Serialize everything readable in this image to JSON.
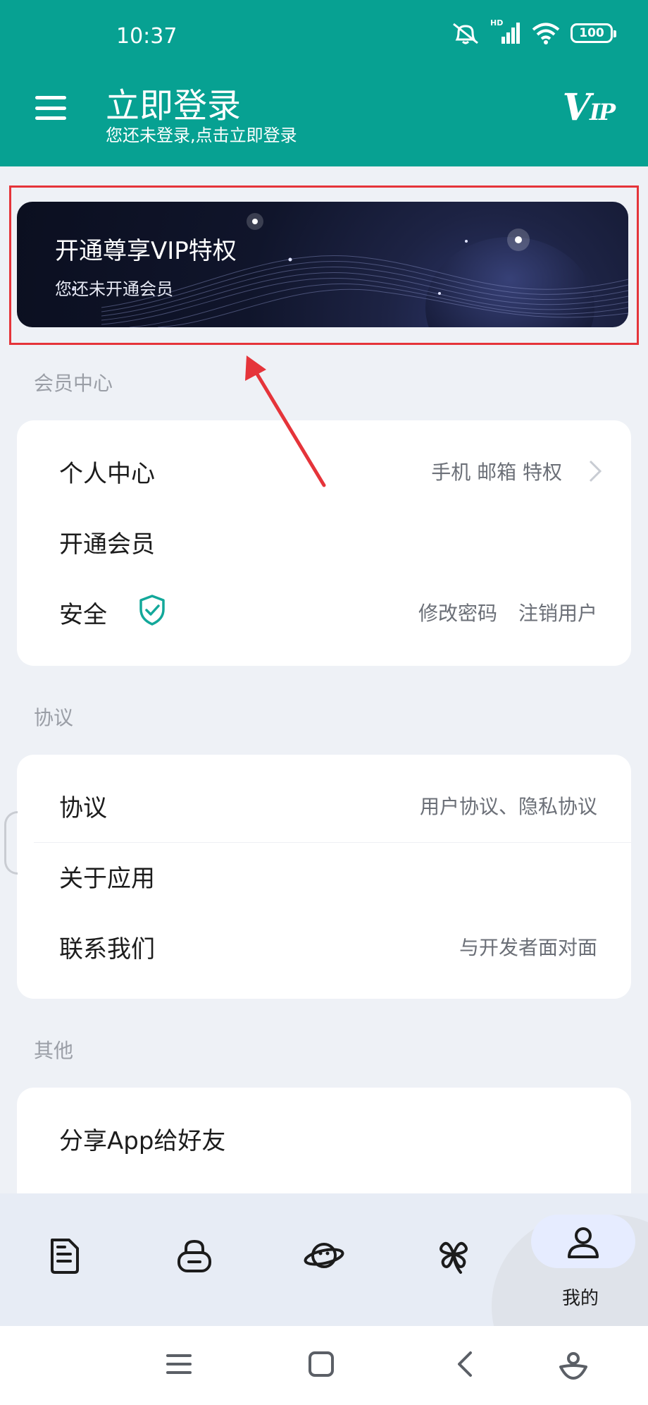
{
  "status_bar": {
    "time": "10:37",
    "hd_label": "HD",
    "battery": "100",
    "icons": [
      "mute-bell-icon",
      "signal-icon",
      "wifi-icon",
      "battery-icon"
    ]
  },
  "header": {
    "title": "立即登录",
    "subtitle": "您还未登录,点击立即登录",
    "vip_logo_main": "V",
    "vip_logo_sub": "IP",
    "bg_color": "#07a192"
  },
  "vip_banner": {
    "title": "开通尊享VIP特权",
    "subtitle": "您还未开通会员"
  },
  "sections": {
    "member": {
      "label": "会员中心",
      "items": [
        {
          "label": "个人中心",
          "right": "手机 邮箱 特权"
        },
        {
          "label": "开通会员",
          "right": ""
        },
        {
          "label": "安全",
          "right_a": "修改密码",
          "right_b": "注销用户"
        }
      ]
    },
    "agreement": {
      "label": "协议",
      "items": [
        {
          "label": "协议",
          "right": "用户协议、隐私协议"
        },
        {
          "label": "关于应用",
          "right": ""
        },
        {
          "label": "联系我们",
          "right": "与开发者面对面"
        }
      ]
    },
    "other": {
      "label": "其他",
      "items": [
        {
          "label": "分享App给好友"
        }
      ]
    }
  },
  "tab_bar": {
    "tabs": [
      {
        "icon": "document-icon"
      },
      {
        "icon": "lock-icon"
      },
      {
        "icon": "planet-icon"
      },
      {
        "icon": "clover-icon"
      },
      {
        "icon": "user-icon",
        "label": "我的",
        "active": true
      }
    ]
  },
  "nav_bar": {
    "buttons": [
      "menu-icon",
      "home-square-icon",
      "back-chevron-icon",
      "assistant-icon"
    ]
  },
  "colors": {
    "accent": "#07a192",
    "highlight_box": "#e5343a",
    "annotation_arrow": "#e5343a"
  }
}
